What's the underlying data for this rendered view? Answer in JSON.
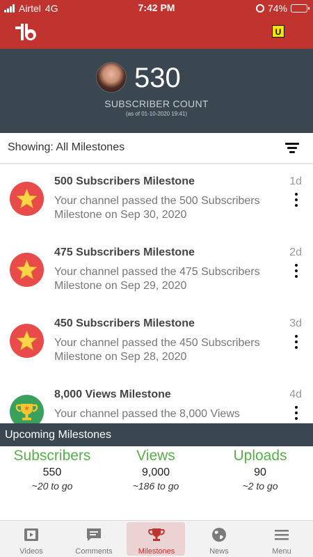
{
  "status_bar": {
    "carrier": "Airtel",
    "network": "4G",
    "time": "7:42 PM",
    "battery": "74%",
    "battery_level": 0.74
  },
  "header": {
    "logo_icon": "tubebuddy-logo-icon",
    "badge": "U"
  },
  "channel": {
    "subscriber_count": "530",
    "label": "SUBSCRIBER COUNT",
    "as_of": "(as of 01-10-2020 19:41)"
  },
  "filter": {
    "text": "Showing: All Milestones",
    "icon": "filter-icon"
  },
  "milestones": [
    {
      "title": "500 Subscribers Milestone",
      "description": "Your channel passed the 500 Subscribers Milestone on Sep 30, 2020",
      "age": "1d",
      "icon": "star-icon",
      "color": "#e94a4a"
    },
    {
      "title": "475 Subscribers Milestone",
      "description": "Your channel passed the 475 Subscribers Milestone on Sep 29, 2020",
      "age": "2d",
      "icon": "star-icon",
      "color": "#e94a4a"
    },
    {
      "title": "450 Subscribers Milestone",
      "description": "Your channel passed the 450 Subscribers Milestone on Sep 28, 2020",
      "age": "3d",
      "icon": "star-icon",
      "color": "#e94a4a"
    },
    {
      "title": "8,000 Views Milestone",
      "description": "Your channel passed the 8,000 Views",
      "age": "4d",
      "icon": "trophy-icon",
      "color": "#3aa15d"
    }
  ],
  "upcoming": {
    "title": "Upcoming Milestones",
    "items": [
      {
        "label": "Subscribers",
        "value": "550",
        "to_go": "~20 to go"
      },
      {
        "label": "Views",
        "value": "9,000",
        "to_go": "~186 to go"
      },
      {
        "label": "Uploads",
        "value": "90",
        "to_go": "~2 to go"
      }
    ]
  },
  "nav": {
    "items": [
      {
        "label": "Videos",
        "icon": "videos-icon"
      },
      {
        "label": "Comments",
        "icon": "comments-icon"
      },
      {
        "label": "Milestones",
        "icon": "trophy-icon",
        "active": true
      },
      {
        "label": "News",
        "icon": "globe-icon"
      },
      {
        "label": "Menu",
        "icon": "hamburger-icon"
      }
    ]
  },
  "colors": {
    "brand_red": "#c0332f",
    "panel_dark": "#3a4750",
    "accent_green": "#5aad4d"
  }
}
